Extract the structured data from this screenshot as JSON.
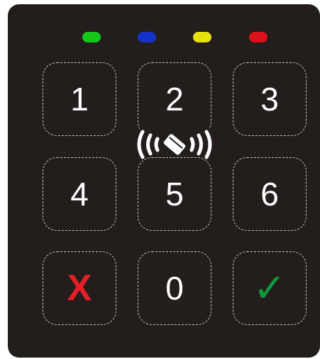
{
  "status_leds": [
    {
      "name": "green",
      "color": "#16c61a"
    },
    {
      "name": "blue",
      "color": "#1533c9"
    },
    {
      "name": "yellow",
      "color": "#e6e10d"
    },
    {
      "name": "red",
      "color": "#d8111b"
    }
  ],
  "keys": {
    "k1": "1",
    "k2": "2",
    "k3": "3",
    "k4": "4",
    "k5": "5",
    "k6": "6",
    "k0": "0",
    "cancel": "X",
    "confirm": "✓"
  },
  "icons": {
    "nfc": "contactless-card-icon",
    "cancel": "cancel-x-icon",
    "confirm": "checkmark-icon"
  },
  "colors": {
    "panel": "#231d1c",
    "key_border": "#c9c4c2",
    "key_text": "#ffffff",
    "cancel": "#e3202a",
    "confirm": "#0f9a3e"
  }
}
